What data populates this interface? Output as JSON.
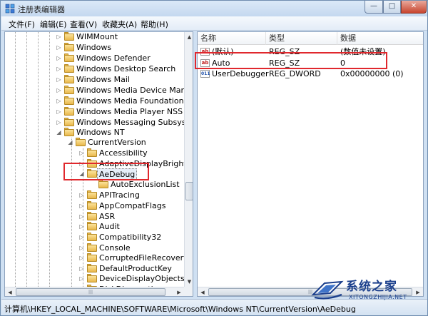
{
  "window": {
    "title": "注册表编辑器",
    "minimize_glyph": "—",
    "maximize_glyph": "□",
    "close_glyph": "✕"
  },
  "menu": [
    {
      "label": "文件(F)"
    },
    {
      "label": "编辑(E)"
    },
    {
      "label": "查看(V)"
    },
    {
      "label": "收藏夹(A)"
    },
    {
      "label": "帮助(H)"
    }
  ],
  "tree": {
    "items": [
      {
        "label": "WIMMount",
        "expander": "▷"
      },
      {
        "label": "Windows",
        "expander": "▷"
      },
      {
        "label": "Windows Defender",
        "expander": "▷"
      },
      {
        "label": "Windows Desktop Search",
        "expander": "▷"
      },
      {
        "label": "Windows Mail",
        "expander": "▷"
      },
      {
        "label": "Windows Media Device Manager",
        "expander": "▷"
      },
      {
        "label": "Windows Media Foundation",
        "expander": "▷"
      },
      {
        "label": "Windows Media Player NSS",
        "expander": "▷"
      },
      {
        "label": "Windows Messaging Subsystem",
        "expander": "▷"
      },
      {
        "label": "Windows NT",
        "expander": "◢"
      },
      {
        "label": "CurrentVersion",
        "expander": "◢"
      },
      {
        "label": "Accessibility",
        "expander": "▷"
      },
      {
        "label": "AdaptiveDisplayBrightness",
        "expander": "▷"
      },
      {
        "label": "AeDebug",
        "expander": "◢",
        "selected": true
      },
      {
        "label": "AutoExclusionList",
        "expander": ""
      },
      {
        "label": "APITracing",
        "expander": "▷"
      },
      {
        "label": "AppCompatFlags",
        "expander": "▷"
      },
      {
        "label": "ASR",
        "expander": "▷"
      },
      {
        "label": "Audit",
        "expander": "▷"
      },
      {
        "label": "Compatibility32",
        "expander": "▷"
      },
      {
        "label": "Console",
        "expander": "▷"
      },
      {
        "label": "CorruptedFileRecovery",
        "expander": "▷"
      },
      {
        "label": "DefaultProductKey",
        "expander": "▷"
      },
      {
        "label": "DeviceDisplayObjects",
        "expander": "▷"
      },
      {
        "label": "DiskDiagnostics",
        "expander": "▷"
      }
    ]
  },
  "list": {
    "columns": {
      "name": "名称",
      "type": "类型",
      "data": "数据"
    },
    "rows": [
      {
        "name": "(默认)",
        "type": "REG_SZ",
        "data": "(数值未设置)",
        "icon": "string-value-icon"
      },
      {
        "name": "Auto",
        "type": "REG_SZ",
        "data": "0",
        "icon": "string-value-icon"
      },
      {
        "name": "UserDebuggerH...",
        "type": "REG_DWORD",
        "data": "0x00000000 (0)",
        "icon": "dword-value-icon"
      }
    ],
    "string_icon_text": "ab",
    "dword_icon_text": "011"
  },
  "status": {
    "path": "计算机\\HKEY_LOCAL_MACHINE\\SOFTWARE\\Microsoft\\Windows NT\\CurrentVersion\\AeDebug"
  },
  "watermark": {
    "title": "系统之家",
    "subtitle": "XITONGZHIJIA.NET"
  },
  "scroll": {
    "up": "▲",
    "down": "▼",
    "left": "◀",
    "right": "▶",
    "grip": "|||"
  },
  "colors": {
    "highlight_box": "#e0282d",
    "folder": "#e9b84c",
    "watermark": "#1b3f8c"
  }
}
